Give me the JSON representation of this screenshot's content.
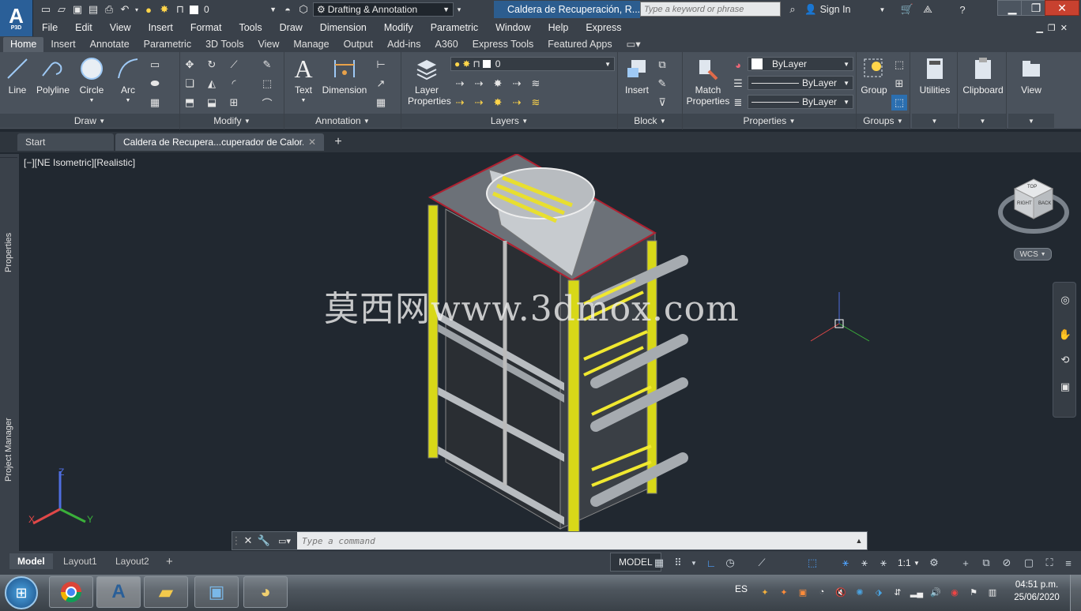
{
  "titlebar": {
    "app_logo": "A",
    "app_logo_sub": "P3D",
    "layer_value": "0",
    "workspace": "Drafting & Annotation",
    "window_title": "Caldera de Recuperación, R...",
    "search_placeholder": "Type a keyword or phrase",
    "sign_in": "Sign In"
  },
  "menubar": [
    "File",
    "Edit",
    "View",
    "Insert",
    "Format",
    "Tools",
    "Draw",
    "Dimension",
    "Modify",
    "Parametric",
    "Window",
    "Help",
    "Express"
  ],
  "ribbon_tabs": [
    "Home",
    "Insert",
    "Annotate",
    "Parametric",
    "3D Tools",
    "View",
    "Manage",
    "Output",
    "Add-ins",
    "A360",
    "Express Tools",
    "Featured Apps"
  ],
  "active_tab": "Home",
  "ribbon": {
    "draw": {
      "label": "Draw",
      "line": "Line",
      "polyline": "Polyline",
      "circle": "Circle",
      "arc": "Arc"
    },
    "modify": {
      "label": "Modify"
    },
    "annotation": {
      "label": "Annotation",
      "text": "Text",
      "dimension": "Dimension"
    },
    "layers": {
      "label": "Layers",
      "layer_properties": "Layer Properties",
      "layer_value": "0"
    },
    "block": {
      "label": "Block",
      "insert": "Insert"
    },
    "properties": {
      "label": "Properties",
      "match": "Match Properties",
      "color": "ByLayer",
      "linetype": "ByLayer",
      "lineweight": "ByLayer"
    },
    "groups": {
      "label": "Groups",
      "group": "Group"
    },
    "utilities": "Utilities",
    "clipboard": "Clipboard",
    "view": "View"
  },
  "doc_tabs": {
    "start": "Start",
    "active": "Caldera de Recupera...cuperador de Calor.*"
  },
  "viewport": {
    "label": "[−][NE Isometric][Realistic]",
    "watermark": "莫西网www.3dmox.com",
    "wcs": "WCS",
    "viewcube": {
      "top": "TOP",
      "front": "RIGHT",
      "right": "BACK"
    },
    "axes": {
      "x": "X",
      "y": "Y",
      "z": "Z"
    }
  },
  "side_palettes": {
    "properties": "Properties",
    "project_manager": "Project Manager"
  },
  "command": {
    "placeholder": "Type a command"
  },
  "layout_tabs": [
    "Model",
    "Layout1",
    "Layout2"
  ],
  "status": {
    "model": "MODEL",
    "scale": "1:1"
  },
  "taskbar": {
    "lang": "ES",
    "time": "04:51 p.m.",
    "date": "25/06/2020"
  },
  "colors": {
    "accent": "#0b6fc6",
    "ribbon": "#4a525c",
    "canvas": "#212830",
    "frame_yellow": "#d8d818",
    "tube_yellow": "#f0e830"
  }
}
